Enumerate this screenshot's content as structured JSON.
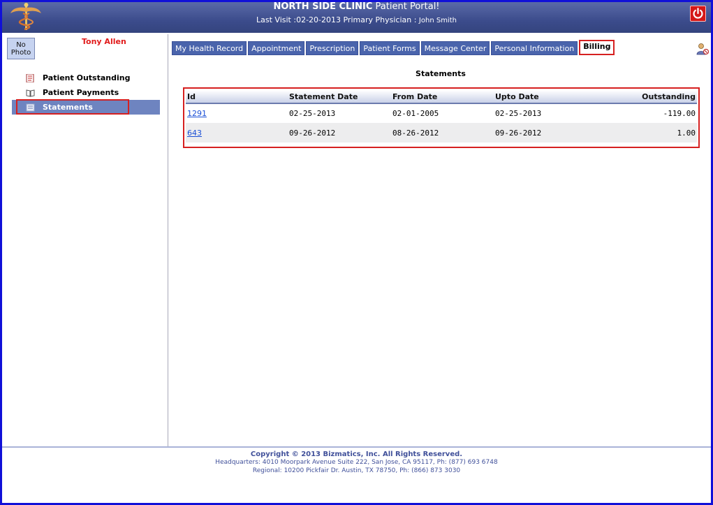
{
  "header": {
    "clinic_name": "NORTH SIDE CLINIC",
    "portal_suffix": " Patient Portal!",
    "last_visit": "Last Visit :02-20-2013  Primary Physician : ",
    "physician": "John Smith",
    "logo_icon": "caduceus-icon",
    "power_icon": "power-icon"
  },
  "sidebar": {
    "photo_label": "No Photo",
    "patient_name": "Tony Allen",
    "items": [
      {
        "label": "Patient Outstanding",
        "icon": "document-icon"
      },
      {
        "label": "Patient Payments",
        "icon": "book-icon"
      },
      {
        "label": "Statements",
        "icon": "statement-icon"
      }
    ]
  },
  "tabs": [
    "My Health Record",
    "Appointment",
    "Prescription",
    "Patient Forms",
    "Message Center",
    "Personal Information",
    "Billing"
  ],
  "statements": {
    "title": "Statements",
    "columns": [
      "Id",
      "Statement Date",
      "From Date",
      "Upto Date",
      "Outstanding"
    ],
    "rows": [
      {
        "id": "1291",
        "statement_date": "02-25-2013",
        "from_date": "02-01-2005",
        "upto_date": "02-25-2013",
        "outstanding": "-119.00"
      },
      {
        "id": "643",
        "statement_date": "09-26-2012",
        "from_date": "08-26-2012",
        "upto_date": "09-26-2012",
        "outstanding": "1.00"
      }
    ]
  },
  "footer": {
    "copyright": "Copyright © 2013 Bizmatics, Inc. All Rights Reserved.",
    "headquarters": "Headquarters: 4010 Moorpark Avenue Suite 222, San Jose, CA 95117, Ph: (877) 693 6748",
    "regional": "Regional: 10200 Pickfair Dr. Austin, TX 78750, Ph: (866) 873 3030"
  },
  "colors": {
    "header_bg": "#3c4c8c",
    "tab_bg": "#4a64ac",
    "active_nav_bg": "#6e84c0",
    "highlight": "#d62020",
    "patient_name": "#e11a1a"
  }
}
